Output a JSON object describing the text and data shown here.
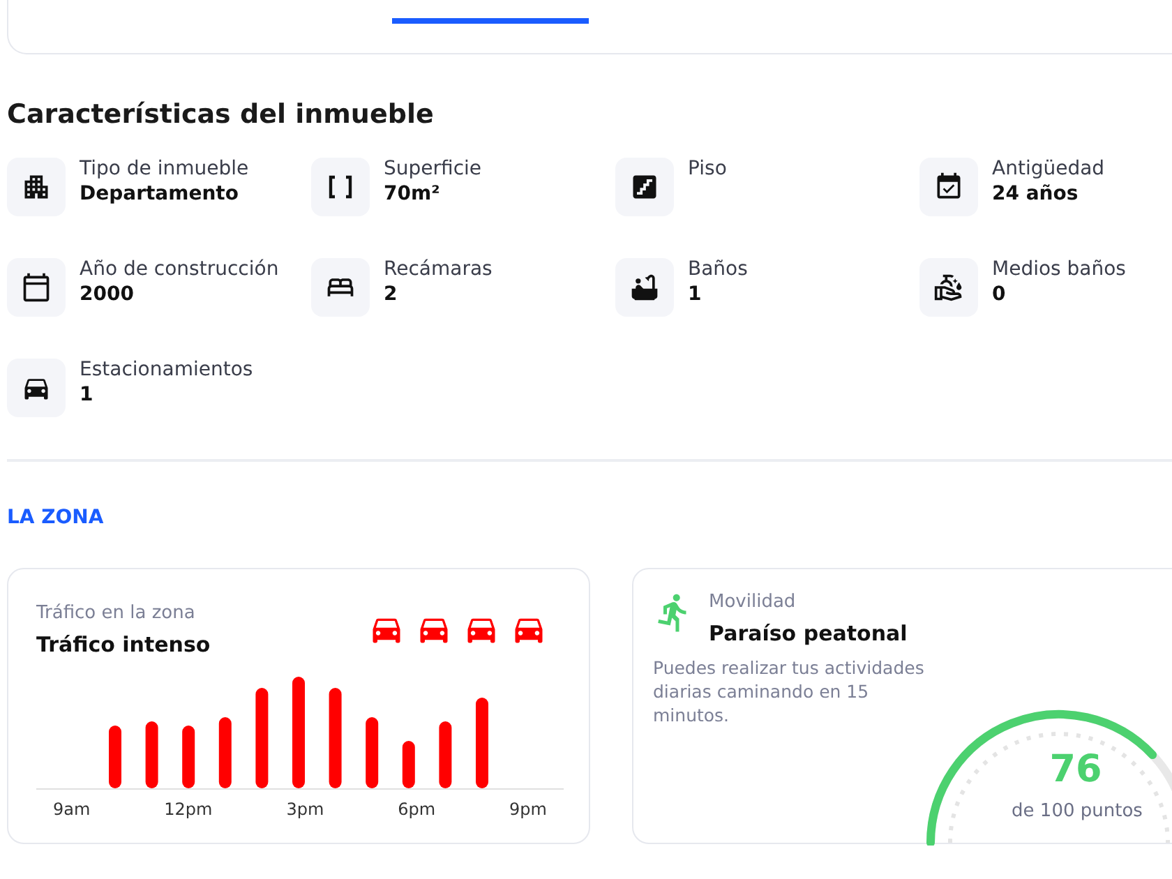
{
  "section_title": "Características del inmueble",
  "features": [
    {
      "label": "Tipo de inmueble",
      "value": "Departamento"
    },
    {
      "label": "Superficie",
      "value": "70m²"
    },
    {
      "label": "Piso"
    },
    {
      "label": "Antigüedad",
      "value": "24 años"
    },
    {
      "label": "Año de construcción",
      "value": "2000"
    },
    {
      "label": "Recámaras",
      "value": "2"
    },
    {
      "label": "Baños",
      "value": "1"
    },
    {
      "label": "Medios baños",
      "value": "0"
    },
    {
      "label": "Estacionamientos",
      "value": "1"
    }
  ],
  "zone_heading": "LA ZONA",
  "traffic": {
    "caption": "Tráfico en la zona",
    "title": "Tráfico intenso",
    "x_labels": [
      "9am",
      "12pm",
      "3pm",
      "6pm",
      "9pm"
    ]
  },
  "mobility": {
    "caption": "Movilidad",
    "title": "Paraíso peatonal",
    "description": "Puedes realizar tus actividades diarias caminando en 15 minutos.",
    "score": "76",
    "score_caption": "de 100 puntos",
    "level": 0.76
  }
}
